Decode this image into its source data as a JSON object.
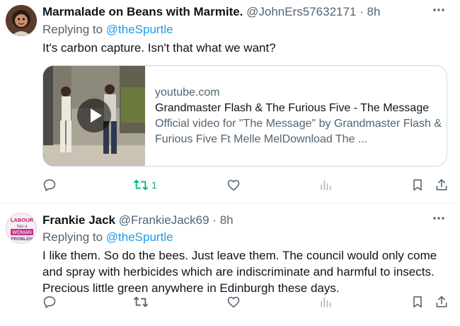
{
  "tweets": [
    {
      "author_name": "Marmalade on Beans with Marmite.",
      "handle": "@JohnErs57632171",
      "dot": "·",
      "time": "8h",
      "replying_prefix": "Replying to",
      "replying_to": "@theSpurtle",
      "text": "It's carbon capture. Isn't that what we want?",
      "card": {
        "domain": "youtube.com",
        "title": "Grandmaster Flash & The Furious Five - The Message",
        "description": "Official video for \"The Message\" by Grandmaster Flash & Furious Five Ft Melle MelDownload The ..."
      },
      "retweet_count": "1"
    },
    {
      "author_name": "Frankie Jack",
      "handle": "@FrankieJack69",
      "dot": "·",
      "time": "8h",
      "replying_prefix": "Replying to",
      "replying_to": "@theSpurtle",
      "text": "I like them. So do the bees. Just leave them. The council would only come and spray with herbicides which are indiscriminate and harmful to insects. Precious little green anywhere in Edinburgh these days.",
      "avatar_sign": [
        "LABOUR",
        "has a",
        "WOMAN",
        "PROBLEM"
      ]
    }
  ],
  "icons": {
    "reply": "reply-icon",
    "retweet": "retweet-icon",
    "like": "heart-icon",
    "views": "analytics-icon",
    "bookmark": "bookmark-icon",
    "share": "share-icon",
    "more": "more-icon",
    "play": "play-icon"
  },
  "colors": {
    "link": "#1d9bf0",
    "secondary_text": "#536471",
    "retweet_active": "#00ba7c",
    "divider": "#eff3f4"
  }
}
